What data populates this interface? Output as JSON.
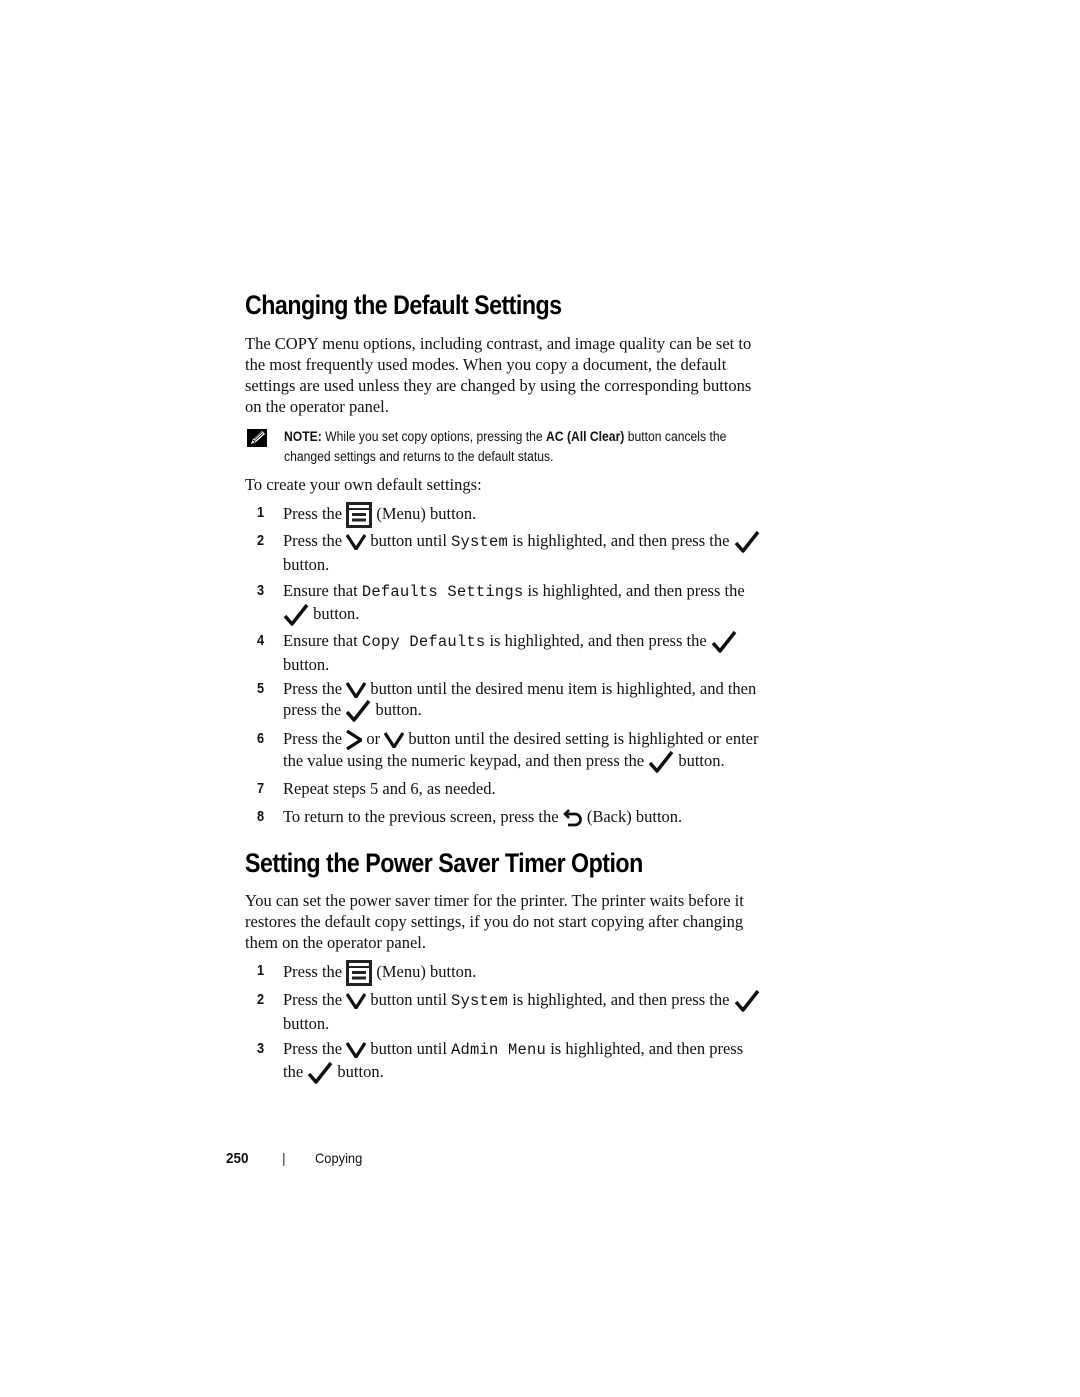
{
  "section1": {
    "heading": "Changing the Default Settings",
    "intro_lines": [
      "The COPY menu options, including contrast, and image quality can be set to",
      "the most frequently used modes. When you copy a document, the default",
      "settings are used unless they are changed by using the corresponding buttons",
      "on the operator panel."
    ],
    "note": {
      "icon": "note-pencil-icon",
      "label": "NOTE:",
      "text_a": " While you set copy options, pressing the ",
      "bold": "AC (All Clear)",
      "text_b": " button cancels the",
      "line2": "changed settings and returns to the default status."
    },
    "lead": "To create your own default settings:",
    "steps": [
      {
        "num": "1",
        "a": "Press the ",
        "b": " (Menu)",
        "c": " button."
      },
      {
        "num": "2",
        "a": "Press the ",
        "b": " button until ",
        "code": "System",
        "c": " is highlighted, and then press the ",
        "line2": "button."
      },
      {
        "num": "3",
        "a": "Ensure that ",
        "code": "Defaults Settings",
        "b": " is highlighted, and then press the",
        "line2": " button."
      },
      {
        "num": "4",
        "a": "Ensure that ",
        "code": "Copy Defaults",
        "b": " is highlighted, and then press the ",
        "line2": "button."
      },
      {
        "num": "5",
        "a": "Press the ",
        "b": " button until the desired menu item is highlighted, and then",
        "line2a": "press the ",
        "line2b": " button."
      },
      {
        "num": "6",
        "a": "Press the ",
        "or": " or ",
        "b": " button until the desired setting is highlighted or enter",
        "line2a": "the value using the numeric keypad, and then press the ",
        "line2b": " button."
      },
      {
        "num": "7",
        "a": "Repeat steps 5 and 6, as needed."
      },
      {
        "num": "8",
        "a": "To return to the previous screen, press the ",
        "b": " (Back)",
        "c": " button."
      }
    ]
  },
  "section2": {
    "heading": "Setting the Power Saver Timer Option",
    "intro_lines": [
      "You can set the power saver timer for the printer. The printer waits before it",
      "restores the default copy settings, if you do not start copying after changing",
      "them on the operator panel."
    ],
    "steps": [
      {
        "num": "1",
        "a": "Press the ",
        "b": " (Menu)",
        "c": " button."
      },
      {
        "num": "2",
        "a": "Press the ",
        "b": " button until ",
        "code": "System",
        "c": " is highlighted, and then press the ",
        "line2": "button."
      },
      {
        "num": "3",
        "a": "Press the ",
        "b": " button until ",
        "code": "Admin Menu",
        "c": " is highlighted, and then press",
        "line2a": "the ",
        "line2b": " button."
      }
    ]
  },
  "footer": {
    "page_number": "250",
    "separator": "|",
    "chapter": "Copying"
  }
}
